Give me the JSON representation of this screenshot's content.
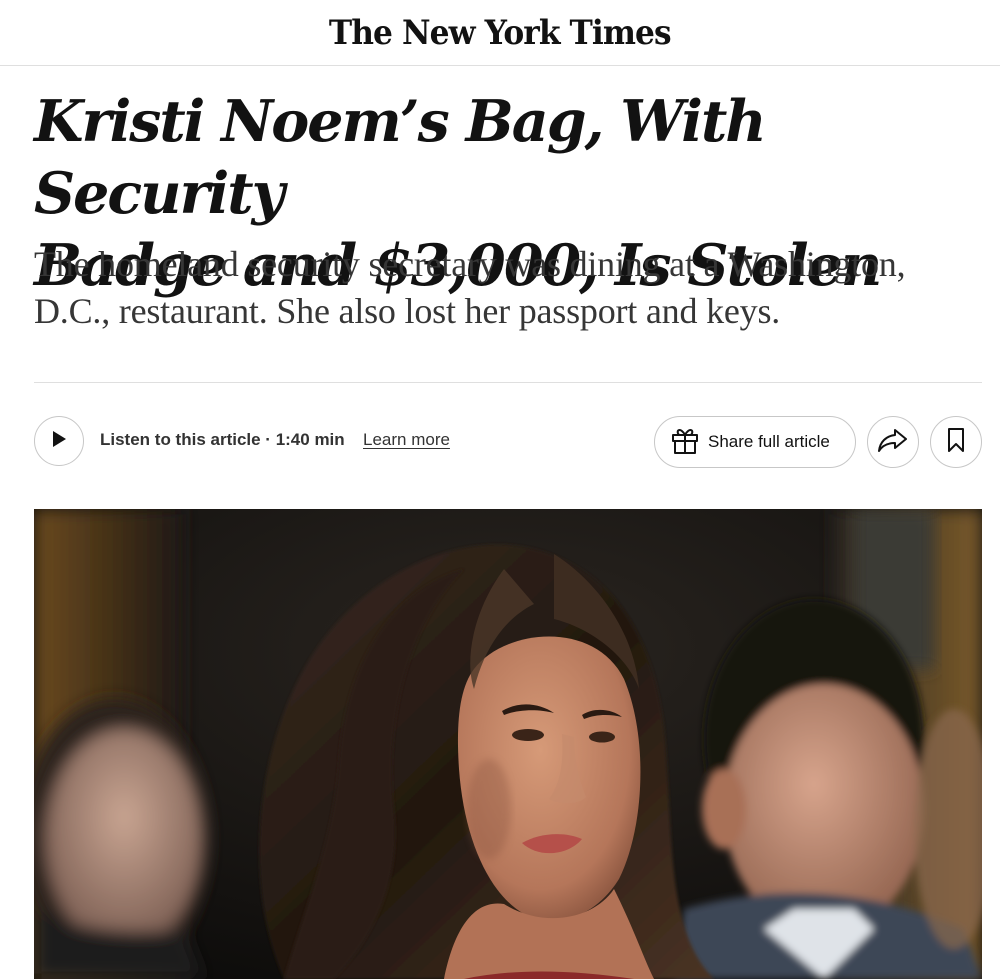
{
  "masthead": {
    "logo_text": "The New York Times"
  },
  "article": {
    "headline_line1": "Kristi Noem’s Bag, With Security",
    "headline_line2": "Badge and $3,000, Is Stolen",
    "summary": "The homeland security secretary was dining at a Washington, D.C., restaurant. She also lost her passport and keys."
  },
  "toolbar": {
    "listen_label": "Listen to this article · 1:40 min",
    "learn_more_label": "Learn more",
    "share_full_label": "Share full article",
    "icons": {
      "play": "play-icon",
      "gift": "gift-icon",
      "share": "share-arrow-icon",
      "bookmark": "bookmark-icon"
    }
  },
  "colors": {
    "text": "#121212",
    "summary_text": "#363636",
    "border": "#c7c7c7",
    "divider": "#dfdfdf"
  }
}
